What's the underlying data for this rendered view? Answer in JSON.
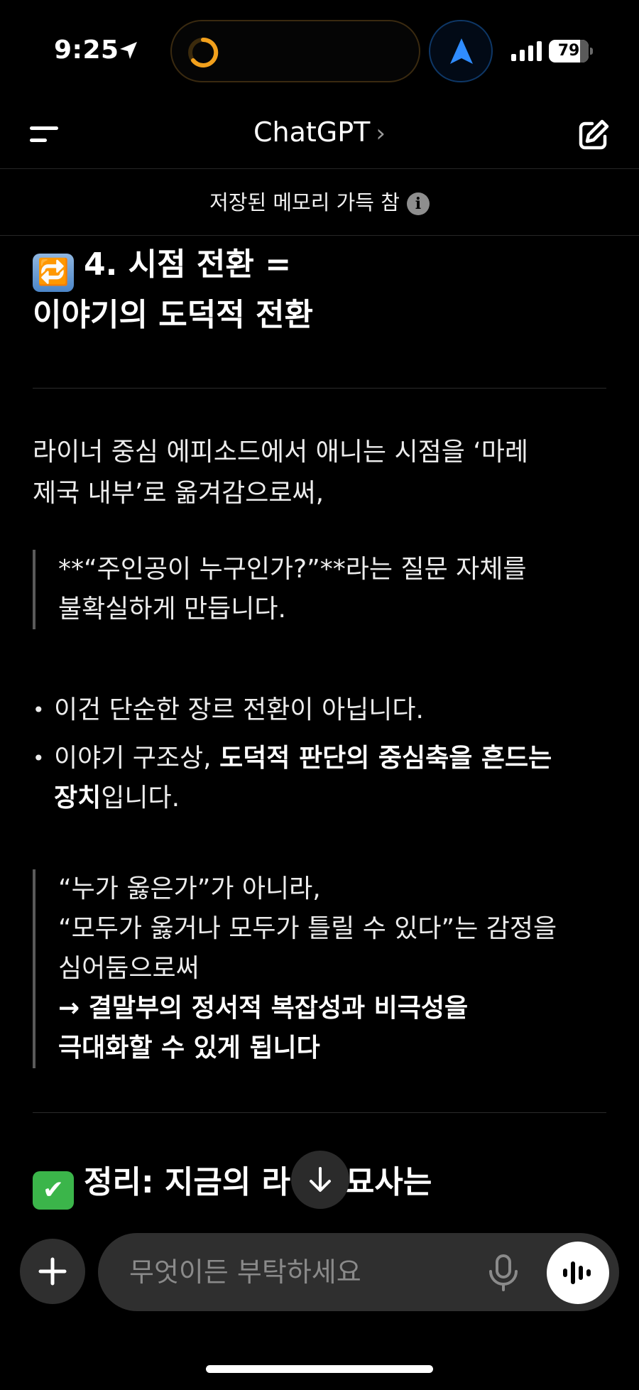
{
  "status_bar": {
    "time": "9:25",
    "battery_level": "79",
    "battery_fraction": 0.79
  },
  "header": {
    "title": "ChatGPT",
    "title_chevron": "›"
  },
  "memory_banner": {
    "text": "저장된 메모리 가득 참",
    "info_glyph": "i"
  },
  "content": {
    "section4": {
      "emoji": "🔁",
      "title_line1": "4. 시점 전환 =",
      "title_line2": "이야기의 도덕적 전환"
    },
    "intro_line1": "라이너 중심 에피소드에서 애니는 시점을 ‘마레",
    "intro_line2": "제국 내부’로 옮겨감으로써,",
    "quote1_line1": "**“주인공이 누구인가?”**라는 질문 자체를",
    "quote1_line2": "불확실하게 만듭니다.",
    "bullet1": "이건 단순한 장르 전환이 아닙니다.",
    "bullet2_prefix": "이야기 구조상, ",
    "bullet2_bold1": "도덕적 판단의 중심축을 흔드는",
    "bullet2_bold2": "장치",
    "bullet2_suffix": "입니다.",
    "quote2_line1": "“누가 옳은가”가 아니라,",
    "quote2_line2": "“모두가 옳거나 모두가 틀릴 수 있다”는 감정을",
    "quote2_line3": "심어둠으로써",
    "quote2_line4": "→ 결말부의 정서적 복잡성과 비극성을",
    "quote2_line5": "극대화할 수 있게 됩니다",
    "summary": {
      "emoji": "✔",
      "title_part1": "정리: 지금의 ",
      "title_part2": "라",
      "title_part3": "너 묘사는"
    }
  },
  "composer": {
    "placeholder": "무엇이든 부탁하세요"
  },
  "icons": {
    "menu": "menu-icon",
    "edit": "new-chat-icon",
    "location": "location-arrow-icon",
    "navigation": "navigation-arrow-icon",
    "signal": "signal-bars-icon",
    "scroll": "arrow-down-icon",
    "plus": "plus-icon",
    "mic": "microphone-icon",
    "voice": "voice-waveform-icon"
  },
  "colors": {
    "background": "#000000",
    "surface": "#2f2f2f",
    "ring_accent": "#f2a01c",
    "nav_blue": "#2f8cff"
  }
}
